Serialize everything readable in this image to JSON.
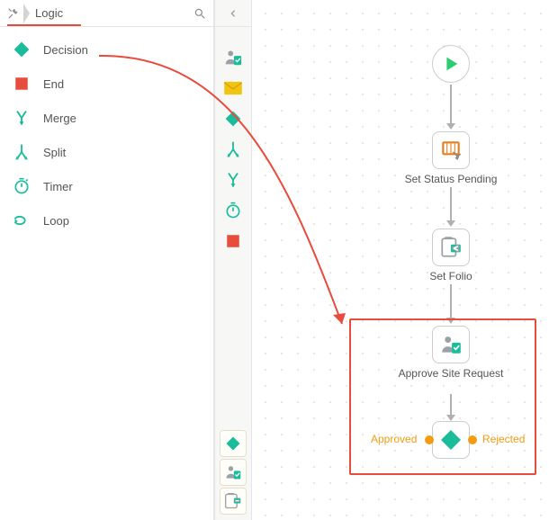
{
  "breadcrumb": {
    "root_icon": "tools",
    "category": "Logic"
  },
  "search": {
    "placeholder": "Search"
  },
  "tools": [
    {
      "key": "decision",
      "label": "Decision"
    },
    {
      "key": "end",
      "label": "End"
    },
    {
      "key": "merge",
      "label": "Merge"
    },
    {
      "key": "split",
      "label": "Split"
    },
    {
      "key": "timer",
      "label": "Timer"
    },
    {
      "key": "loop",
      "label": "Loop"
    }
  ],
  "mini_top": [
    "user-task-icon",
    "mail-icon",
    "decision-icon",
    "split-icon",
    "merge-icon",
    "timer-icon",
    "end-icon"
  ],
  "mini_bottom": [
    "decision-icon",
    "user-task-icon",
    "subprocess-icon"
  ],
  "workflow": {
    "start": "Start",
    "step1": "Set Status Pending",
    "step2": "Set Folio",
    "step3": "Approve Site Request",
    "decision_out": {
      "left": "Approved",
      "right": "Rejected"
    }
  },
  "colors": {
    "teal": "#1abc9c",
    "red": "#e74c3c",
    "orange": "#f39c12",
    "mailYellow": "#f1c40f",
    "smartBlue": "#3498db",
    "grey": "#9aa1a8"
  }
}
